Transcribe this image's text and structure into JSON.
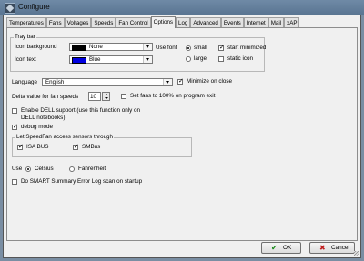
{
  "window": {
    "title": "Configure"
  },
  "tabs": [
    "Temperatures",
    "Fans",
    "Voltages",
    "Speeds",
    "Fan Control",
    "Options",
    "Log",
    "Advanced",
    "Events",
    "Internet",
    "Mail",
    "xAP"
  ],
  "tray_bar": {
    "label": "Tray bar",
    "icon_background_label": "Icon background",
    "icon_background_value": "None",
    "icon_background_color": "#000000",
    "icon_text_label": "Icon text",
    "icon_text_value": "Blue",
    "icon_text_color": "#0000e0",
    "use_font_label": "Use font",
    "small_label": "small",
    "large_label": "large",
    "start_minimized_label": "start minimized",
    "static_icon_label": "static icon"
  },
  "language": {
    "label": "Language",
    "value": "English"
  },
  "minimize_on_close_label": "Minimize on close",
  "delta": {
    "label": "Delta value for fan speeds",
    "value": "10"
  },
  "set_fans_label": "Set fans to 100% on program exit",
  "dell": {
    "line1": "Enable DELL support (use this function only on",
    "line2": "DELL notebooks)"
  },
  "debug_mode_label": "debug mode",
  "sensors": {
    "label": "Let SpeedFan access sensors through",
    "isa_bus_label": "ISA BUS",
    "smbus_label": "SMBus"
  },
  "use": {
    "label": "Use",
    "celsius_label": "Celsius",
    "fahrenheit_label": "Fahrenheit"
  },
  "smart_label": "Do SMART Summary Error Log scan on startup",
  "buttons": {
    "ok_label": "OK",
    "cancel_label": "Cancel",
    "ok_icon": "checkmark-icon",
    "cancel_icon": "cross-icon"
  }
}
